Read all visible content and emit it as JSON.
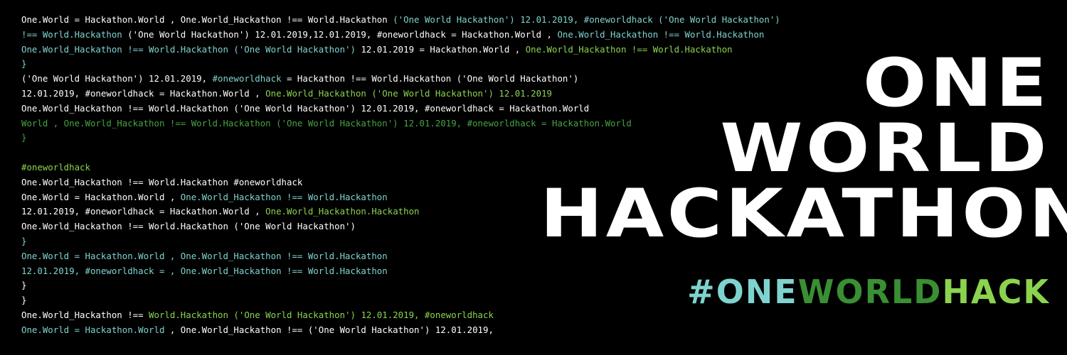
{
  "colors": {
    "background": "#000000",
    "white": "#ffffff",
    "teal": "#7fd3cf",
    "light_green": "#8bd34f",
    "green": "#47a342",
    "dark_green": "#3a8f34"
  },
  "code_lines": [
    [
      {
        "text": "One.World = Hackathon.World , One.World_Hackathon !== World.Hackathon ",
        "color": "w"
      },
      {
        "text": "('One World Hackathon') 12.01.2019, #oneworldhack ('One World Hackathon')",
        "color": "t"
      }
    ],
    [
      {
        "text": "!== World.Hackathon ",
        "color": "t"
      },
      {
        "text": "('One World Hackathon') 12.01.2019,12.01.2019, #oneworldhack = Hackathon.World , ",
        "color": "w"
      },
      {
        "text": "One.World_Hackathon !== World.Hackathon",
        "color": "t"
      }
    ],
    [
      {
        "text": "One.World_Hackathon !== World.Hackathon ('One World Hackathon') ",
        "color": "t"
      },
      {
        "text": "12.01.2019 = Hackathon.World , ",
        "color": "w"
      },
      {
        "text": "One.World_Hackathon !== World.Hackathon",
        "color": "l"
      }
    ],
    [
      {
        "text": "}",
        "color": "t"
      }
    ],
    [
      {
        "text": "('One World Hackathon') 12.01.2019, ",
        "color": "w"
      },
      {
        "text": "#oneworldhack",
        "color": "t"
      },
      {
        "text": " = Hackathon !== World.Hackathon ('One World Hackathon')",
        "color": "w"
      }
    ],
    [
      {
        "text": "12.01.2019, #oneworldhack = Hackathon.World , ",
        "color": "w"
      },
      {
        "text": "One.World_Hackathon ('One World Hackathon') 12.01.2019",
        "color": "l"
      }
    ],
    [
      {
        "text": "One.World_Hackathon !== World.Hackathon ('One World Hackathon') 12.01.2019, #oneworldhack = Hackathon.World",
        "color": "w"
      }
    ],
    [
      {
        "text": "World , One.World_Hackathon !== World.Hackathon ('One World Hackathon') 12.01.2019, #oneworldhack = Hackathon.World",
        "color": "g"
      }
    ],
    [
      {
        "text": "}",
        "color": "g"
      }
    ],
    [
      {
        "text": "",
        "color": "w"
      }
    ],
    [
      {
        "text": "#oneworldhack",
        "color": "l"
      }
    ],
    [
      {
        "text": "One.World_Hackathon !== World.Hackathon #oneworldhack",
        "color": "w"
      }
    ],
    [
      {
        "text": "One.World = Hackathon.World , ",
        "color": "w"
      },
      {
        "text": "One.World_Hackathon !== World.Hackathon",
        "color": "t"
      }
    ],
    [
      {
        "text": "12.01.2019, #oneworldhack = Hackathon.World , ",
        "color": "w"
      },
      {
        "text": "One.World_Hackathon.Hackathon",
        "color": "l"
      }
    ],
    [
      {
        "text": "One.World_Hackathon !== World.Hackathon ('One World Hackathon')",
        "color": "w"
      }
    ],
    [
      {
        "text": "}",
        "color": "t"
      }
    ],
    [
      {
        "text": "One.World = Hackathon.World , One.World_Hackathon !== World.Hackathon",
        "color": "t"
      }
    ],
    [
      {
        "text": "12.01.2019, #oneworldhack = , One.World_Hackathon !== World.Hackathon",
        "color": "t"
      }
    ],
    [
      {
        "text": "}",
        "color": "w"
      }
    ],
    [
      {
        "text": "}",
        "color": "w"
      }
    ],
    [
      {
        "text": "One.World_Hackathon !== ",
        "color": "w"
      },
      {
        "text": "World.Hackathon ('One World Hackathon') 12.01.2019, #oneworldhack",
        "color": "l"
      }
    ],
    [
      {
        "text": "One.World = Hackathon.World ",
        "color": "t"
      },
      {
        "text": ", One.World_Hackathon !== ('One World Hackathon') 12.01.2019,",
        "color": "w"
      }
    ]
  ],
  "logo": {
    "line1": "ONE",
    "line2": "WORLD",
    "line3": "HACKATHON"
  },
  "hashtag": {
    "parts": [
      {
        "text": "#",
        "color": "#7fd3cf"
      },
      {
        "text": "ONE",
        "color": "#7fd3cf"
      },
      {
        "text": "WORLD",
        "color": "#3a8f34"
      },
      {
        "text": "HACK",
        "color": "#8bd34f"
      }
    ]
  }
}
